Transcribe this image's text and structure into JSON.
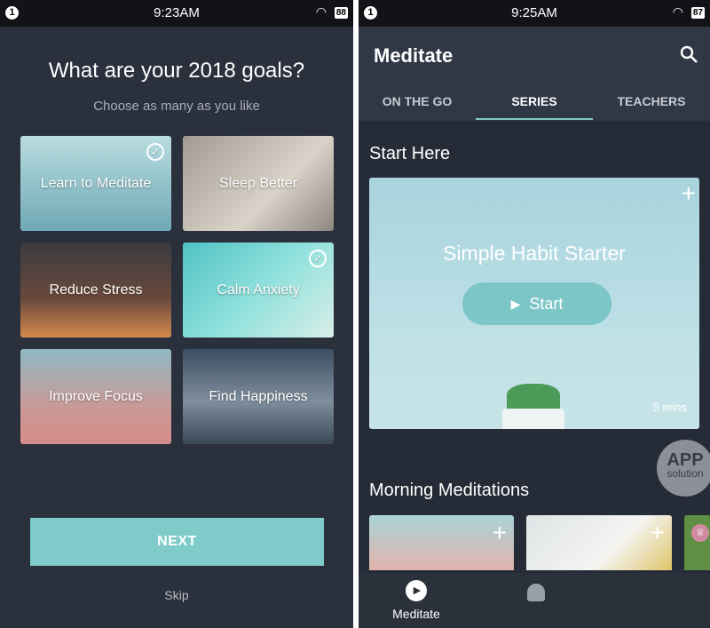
{
  "left": {
    "status": {
      "badge": "1",
      "time": "9:23AM",
      "battery": "88"
    },
    "title": "What are your 2018 goals?",
    "subtitle": "Choose as many as you like",
    "goals": [
      {
        "label": "Learn to Meditate",
        "selected": true
      },
      {
        "label": "Sleep Better",
        "selected": false
      },
      {
        "label": "Reduce Stress",
        "selected": false
      },
      {
        "label": "Calm Anxiety",
        "selected": true
      },
      {
        "label": "Improve Focus",
        "selected": false
      },
      {
        "label": "Find Happiness",
        "selected": false
      }
    ],
    "next_label": "NEXT",
    "skip_label": "Skip"
  },
  "right": {
    "status": {
      "badge": "1",
      "time": "9:25AM",
      "battery": "87"
    },
    "header_title": "Meditate",
    "tabs": [
      {
        "label": "ON THE GO"
      },
      {
        "label": "SERIES",
        "active": true
      },
      {
        "label": "TEACHERS"
      }
    ],
    "section1": "Start Here",
    "featured": {
      "title": "Simple Habit Starter",
      "button": "Start",
      "duration": "5 mins"
    },
    "section2": "Morning Meditations",
    "nav": [
      {
        "label": "Meditate",
        "icon": "play-circle-icon"
      }
    ],
    "watermark": "APP solution"
  },
  "colors": {
    "accent": "#7fcbc9",
    "bg": "#2a303c"
  }
}
